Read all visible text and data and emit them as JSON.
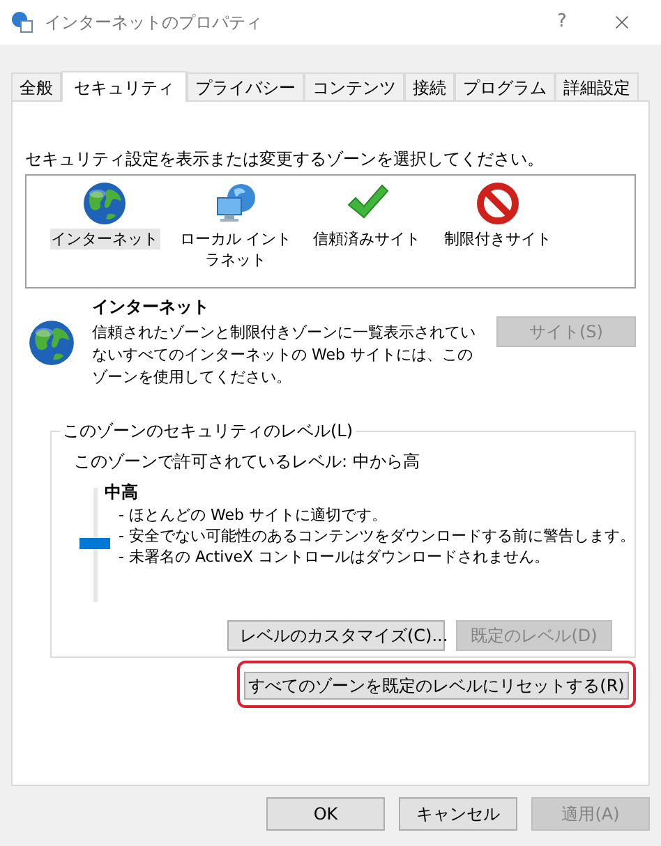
{
  "window": {
    "title": "インターネットのプロパティ",
    "help": "?"
  },
  "tabs": [
    {
      "label": "全般",
      "selected": false
    },
    {
      "label": "セキュリティ",
      "selected": true
    },
    {
      "label": "プライバシー",
      "selected": false
    },
    {
      "label": "コンテンツ",
      "selected": false
    },
    {
      "label": "接続",
      "selected": false
    },
    {
      "label": "プログラム",
      "selected": false
    },
    {
      "label": "詳細設定",
      "selected": false
    }
  ],
  "instruction": "セキュリティ設定を表示または変更するゾーンを選択してください。",
  "zones": [
    {
      "kind": "globe",
      "label": "インターネット",
      "selected": true
    },
    {
      "kind": "network",
      "label": "ローカル イントラネット",
      "selected": false
    },
    {
      "kind": "check",
      "label": "信頼済みサイト",
      "selected": false
    },
    {
      "kind": "blocked",
      "label": "制限付きサイト",
      "selected": false
    }
  ],
  "zone_detail": {
    "title": "インターネット",
    "description": "信頼されたゾーンと制限付きゾーンに一覧表示されていないすべてのインターネットの Web サイトには、このゾーンを使用してください。",
    "sites_button": {
      "label": "サイト(S)",
      "disabled": true
    }
  },
  "security_level": {
    "legend": "このゾーンのセキュリティのレベル(L)",
    "allowed": "このゾーンで許可されているレベル: 中から高",
    "level": 0.5,
    "name": "中高",
    "bullets": [
      "- ほとんどの Web サイトに適切です。",
      "- 安全でない可能性のあるコンテンツをダウンロードする前に警告します。",
      "- 未署名の ActiveX コントロールはダウンロードされません。"
    ],
    "buttons": [
      {
        "label": "レベルのカスタマイズ(C)...",
        "disabled": false
      },
      {
        "label": "既定のレベル(D)",
        "disabled": true
      }
    ]
  },
  "reset_button": {
    "label": "すべてのゾーンを既定のレベルにリセットする(R)",
    "highlighted": true
  },
  "dialog_buttons": [
    {
      "label": "OK",
      "disabled": false
    },
    {
      "label": "キャンセル",
      "disabled": false
    },
    {
      "label": "適用(A)",
      "disabled": true
    }
  ]
}
